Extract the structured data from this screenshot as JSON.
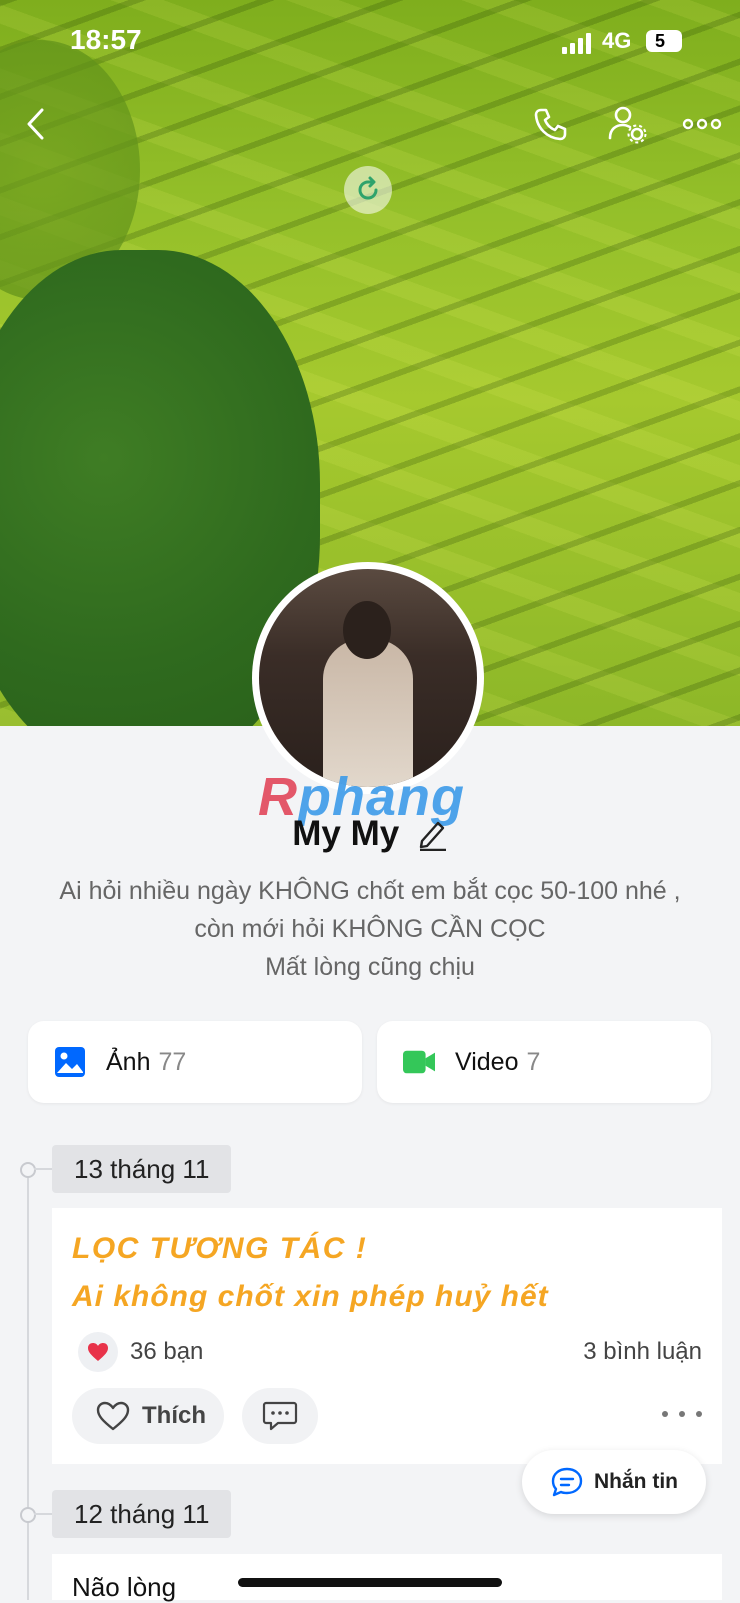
{
  "status_bar": {
    "time": "18:57",
    "network": "4G",
    "battery": "5"
  },
  "colors": {
    "accent_blue": "#0068ff",
    "video_green": "#34c759",
    "post_text": "#f5a623",
    "heart": "#e8334a"
  },
  "header": {
    "back_icon": "chevron-left-icon",
    "call_icon": "phone-icon",
    "settings_icon": "user-settings-icon",
    "more_icon": "ellipsis-icon",
    "reload_icon": "refresh-icon"
  },
  "watermark": {
    "text_red": "R",
    "text_blue": "phang"
  },
  "profile": {
    "name": "My My",
    "bio_lines": [
      "Ai hỏi nhiều ngày KHÔNG chốt em bắt cọc 50-100 nhé ,",
      "còn mới hỏi KHÔNG CẦN CỌC",
      "Mất lòng cũng chịu"
    ]
  },
  "media": {
    "photos_label": "Ảnh",
    "photos_count": "77",
    "videos_label": "Video",
    "videos_count": "7"
  },
  "timeline": [
    {
      "date": "13 tháng 11",
      "post": {
        "line1": "LỌC TƯƠNG TÁC !",
        "line2": "Ai không chốt xin phép huỷ hết",
        "reactions": "36 bạn",
        "comments": "3 bình luận",
        "like_label": "Thích"
      }
    },
    {
      "date": "12 tháng 11",
      "post": {
        "text": "Não lòng"
      }
    }
  ],
  "message_button": {
    "label": "Nhắn tin"
  }
}
